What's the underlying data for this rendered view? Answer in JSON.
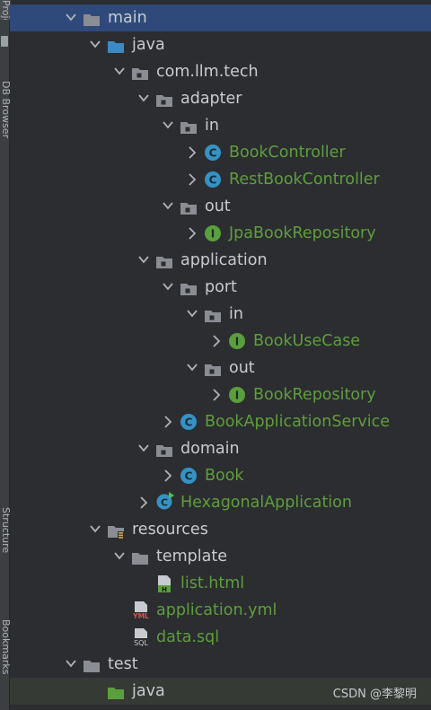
{
  "sidebar": {
    "tabs": [
      "Project",
      "DB Browser",
      "Structure",
      "Bookmarks"
    ]
  },
  "tree": {
    "items": [
      {
        "label": "main",
        "type": "folder-src",
        "depth": 0,
        "expanded": true,
        "selected": true
      },
      {
        "label": "java",
        "type": "folder-source",
        "depth": 1,
        "expanded": true
      },
      {
        "label": "com.llm.tech",
        "type": "package",
        "depth": 2,
        "expanded": true
      },
      {
        "label": "adapter",
        "type": "package",
        "depth": 3,
        "expanded": true
      },
      {
        "label": "in",
        "type": "package",
        "depth": 4,
        "expanded": true
      },
      {
        "label": "BookController",
        "type": "class",
        "depth": 5,
        "expanded": false
      },
      {
        "label": "RestBookController",
        "type": "class",
        "depth": 5,
        "expanded": false
      },
      {
        "label": "out",
        "type": "package",
        "depth": 4,
        "expanded": true
      },
      {
        "label": "JpaBookRepository",
        "type": "interface",
        "depth": 5,
        "expanded": false
      },
      {
        "label": "application",
        "type": "package",
        "depth": 3,
        "expanded": true
      },
      {
        "label": "port",
        "type": "package",
        "depth": 4,
        "expanded": true
      },
      {
        "label": "in",
        "type": "package",
        "depth": 5,
        "expanded": true
      },
      {
        "label": "BookUseCase",
        "type": "interface",
        "depth": 6,
        "expanded": false
      },
      {
        "label": "out",
        "type": "package",
        "depth": 5,
        "expanded": true
      },
      {
        "label": "BookRepository",
        "type": "interface",
        "depth": 6,
        "expanded": false
      },
      {
        "label": "BookApplicationService",
        "type": "class",
        "depth": 4,
        "expanded": false
      },
      {
        "label": "domain",
        "type": "package",
        "depth": 3,
        "expanded": true
      },
      {
        "label": "Book",
        "type": "class",
        "depth": 4,
        "expanded": false
      },
      {
        "label": "HexagonalApplication",
        "type": "app-class",
        "depth": 3,
        "expanded": false
      },
      {
        "label": "resources",
        "type": "folder-resources",
        "depth": 1,
        "expanded": true
      },
      {
        "label": "template",
        "type": "folder",
        "depth": 2,
        "expanded": true
      },
      {
        "label": "list.html",
        "type": "html",
        "depth": 3,
        "expanded": null
      },
      {
        "label": "application.yml",
        "type": "yml",
        "depth": 2,
        "expanded": null
      },
      {
        "label": "data.sql",
        "type": "sql",
        "depth": 2,
        "expanded": null
      },
      {
        "label": "test",
        "type": "folder-src",
        "depth": 0,
        "expanded": true
      },
      {
        "label": "java",
        "type": "folder-test-source",
        "depth": 1,
        "expanded": null,
        "open": true
      }
    ]
  },
  "watermark": "CSDN @李黎明",
  "colors": {
    "selected": "#2f4a7a",
    "green": "#5f9e3d",
    "class_icon": "#3592c4",
    "interface_icon": "#5a9f3c",
    "folder": "#8a8e94",
    "source_folder": "#3d89c4"
  }
}
